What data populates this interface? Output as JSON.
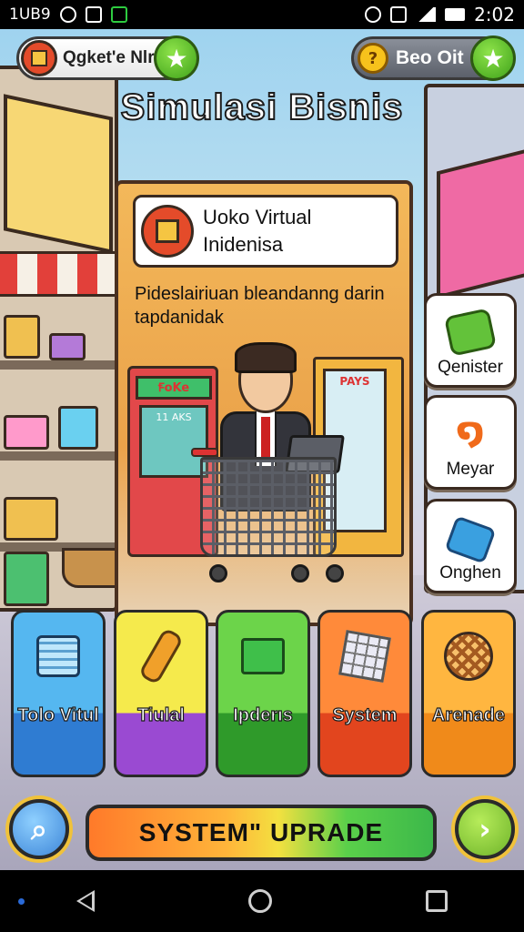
{
  "status_bar": {
    "left_text": "1UB9",
    "time": "2:02"
  },
  "header": {
    "profile_label": "Qgket'e Nlral",
    "currency_label": "Beo Oit",
    "coin_symbol": "?",
    "title": "Simulasi Bisnis"
  },
  "card": {
    "name_line1": "Uoko Virtual",
    "name_line2": "Inidenisa",
    "description": "Pideslairiuan bleandanng darin tapdanidak",
    "machine_sign": "ꞘoKe",
    "machine_screen": "11 AKS",
    "fridge_sign": "PAYS"
  },
  "side_buttons": [
    {
      "label": "Qenister",
      "icon": "puzzle-icon"
    },
    {
      "label": "Meyar",
      "icon": "swirl-icon"
    },
    {
      "label": "Onghen",
      "icon": "cube-icon"
    }
  ],
  "tiles": [
    {
      "label": "Tolo Vitul",
      "icon": "briefcase-icon",
      "color": "#55b7f0"
    },
    {
      "label": "Tiulal",
      "icon": "tube-icon",
      "color": "#f5ea4c"
    },
    {
      "label": "Ipderıs",
      "icon": "box-icon",
      "color": "#6cd44a"
    },
    {
      "label": "System",
      "icon": "cube-grid-icon",
      "color": "#ff8a3a"
    },
    {
      "label": "Arenade",
      "icon": "ball-icon",
      "color": "#ffb640"
    }
  ],
  "bottom": {
    "upgrade_label": "SYSTEM\" UPRADE",
    "left_icon": "magnifier-icon",
    "right_icon": "chevron-right-icon"
  }
}
